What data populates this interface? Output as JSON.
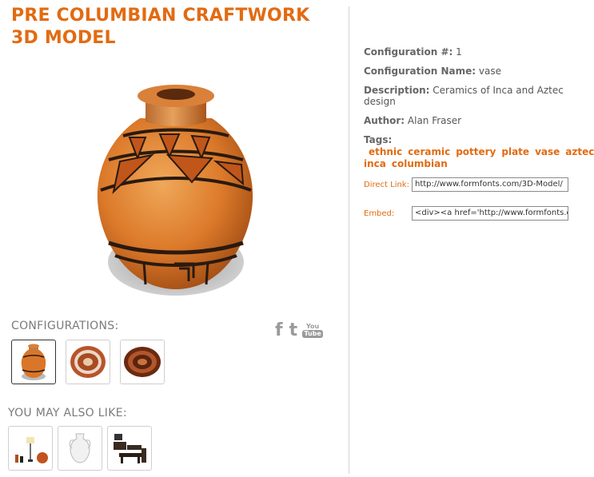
{
  "header": {
    "title_line1": "PRE COLUMBIAN CRAFTWORK",
    "title_line2": "3D MODEL"
  },
  "colors": {
    "accent": "#e26b12",
    "label": "#7b7b7b",
    "divider": "#d4d4d4"
  },
  "configurations": {
    "label": "CONFIGURATIONS:",
    "items": [
      "vase",
      "plate-1",
      "plate-2"
    ],
    "selected_index": 0
  },
  "social": {
    "facebook": "f",
    "twitter": "t",
    "youtube_top": "You",
    "youtube_bottom": "Tube"
  },
  "related": {
    "label": "YOU MAY ALSO LIKE:"
  },
  "details": {
    "config_number_label": "Configuration #:",
    "config_number_value": "1",
    "config_name_label": "Configuration Name:",
    "config_name_value": "vase",
    "description_label": "Description:",
    "description_value": "Ceramics of Inca and Aztec design",
    "author_label": "Author:",
    "author_value": "Alan Fraser",
    "tags_label": "Tags:",
    "tags": [
      "ethnic",
      "ceramic",
      "pottery",
      "plate",
      "vase",
      "aztec",
      "inca",
      "columbian"
    ],
    "direct_link_label": "Direct Link:",
    "direct_link_value": "http://www.formfonts.com/3D-Model/",
    "embed_label": "Embed:",
    "embed_value": "<div><a href='http://www.formfonts.c"
  }
}
